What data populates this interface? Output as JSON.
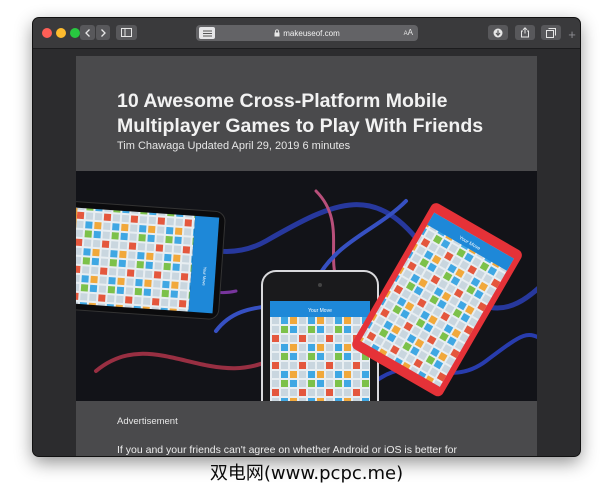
{
  "browser": {
    "url": "makeuseof.com",
    "text_size_small": "A",
    "text_size_large": "A",
    "icons": {
      "close": "close-icon",
      "minimize": "minimize-icon",
      "zoom": "zoom-icon",
      "back": "chevron-left-icon",
      "forward": "chevron-right-icon",
      "sidebar": "sidebar-icon",
      "reader": "reader-icon",
      "lock": "lock-icon",
      "download": "download-icon",
      "share": "share-icon",
      "tabs": "tabs-icon",
      "new_tab": "plus-icon"
    },
    "new_tab_label": "+"
  },
  "article": {
    "title": "10 Awesome Cross-Platform Mobile Multiplayer Games to Play With Friends",
    "byline": "Tim Chawaga Updated April 29, 2019 6 minutes",
    "advertisement_label": "Advertisement",
    "body_first_line": "If you and your friends can't agree on whether Android or iOS is better for"
  },
  "hero_image": {
    "phone_header_text": "Your Move"
  },
  "watermark": "双电网(www.pcpc.me)",
  "colors": {
    "window_bg": "#2b2b2c",
    "toolbar_bg": "#3a3a3c",
    "article_bg": "#4a4a4c",
    "close": "#fe5f57",
    "minimize": "#febc2e",
    "zoom": "#28c840",
    "phone_blue": "#1e88d8",
    "red_phone": "#e53238"
  }
}
